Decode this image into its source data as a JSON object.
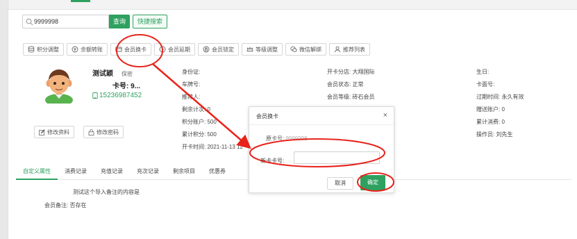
{
  "search": {
    "value": "9999998",
    "query_label": "查询",
    "quick_label": "快捷搜索"
  },
  "actions": [
    {
      "label": "积分调整",
      "icon": "database-icon"
    },
    {
      "label": "余额转账",
      "icon": "coin-icon"
    },
    {
      "label": "会员换卡",
      "icon": "card-icon"
    },
    {
      "label": "会员延期",
      "icon": "clock-icon"
    },
    {
      "label": "会员锁定",
      "icon": "lock-icon"
    },
    {
      "label": "等级调整",
      "icon": "crown-icon"
    },
    {
      "label": "微信解绑",
      "icon": "wechat-icon"
    },
    {
      "label": "推荐列表",
      "icon": "user-icon"
    }
  ],
  "member": {
    "name": "测试颖",
    "secret": "保密",
    "card_no": "卡号: 9...",
    "phone": "15236987452",
    "edit_profile": "修改资料",
    "edit_password": "修改密码"
  },
  "info_col1": [
    "身份证:",
    "车牌号:",
    "推荐人:",
    "剩余计次: 0",
    "积分账户: 500",
    "累计积分: 500",
    "开卡时间: 2021-11-13 12"
  ],
  "info_col2": [
    "开卡分店: 大翔国际",
    "会员状态: 正常",
    "会员等级: 砖石会员"
  ],
  "info_col3": [
    "生日:",
    "卡面号:",
    "过期时间: 永久有效",
    "赠送账户: 0",
    "累计消费: 0",
    "操作员: 刘先生"
  ],
  "tabs": [
    "自定义属性",
    "消费记录",
    "充值记录",
    "充次记录",
    "剩余项目",
    "优惠券"
  ],
  "custom": {
    "note_line": "测试这个导入备注的内容是",
    "remark_label": "会员备注: 否存在"
  },
  "dialog": {
    "title": "会员换卡",
    "close": "×",
    "old_label": "原卡号: ",
    "old_value": "9999998",
    "new_label": "新卡卡号:",
    "cancel": "取消",
    "confirm": "确定"
  },
  "colors": {
    "brand": "#2ea160",
    "annotation": "#e8231b"
  }
}
